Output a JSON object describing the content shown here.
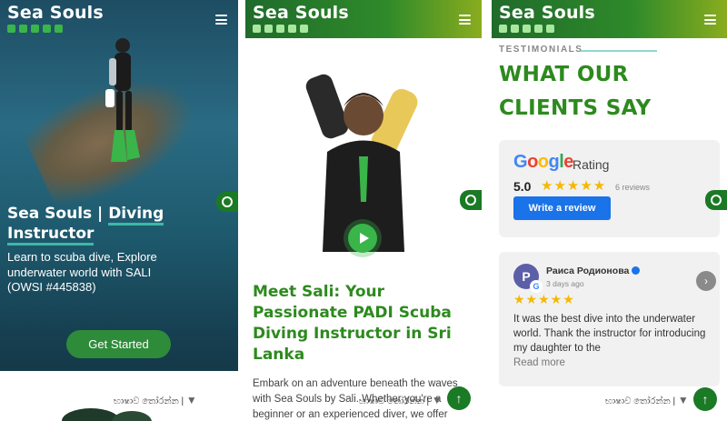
{
  "brand": "Sea Souls",
  "social_icons": [
    "youtube-icon",
    "facebook-icon",
    "instagram-icon",
    "whatsapp-icon",
    "tiktok-icon"
  ],
  "colors": {
    "primary_green": "#2d8a1e",
    "button_green": "#2e8b3a",
    "whatsapp_green": "#1a7a25",
    "google_blue": "#1a73e8",
    "star_gold": "#f5b800"
  },
  "panel1": {
    "hero_title_plain": "Sea Souls | ",
    "hero_title_highlight_1": "Diving",
    "hero_title_highlight_2": "Instructor",
    "hero_subtitle": "Learn to scuba dive, Explore underwater world with SALI (OWSI #445838)",
    "cta_label": "Get Started",
    "translate_label": "භාෂාව තෝරන්න"
  },
  "panel2": {
    "heading": "Meet Sali: Your Passionate PADI Scuba Diving Instructor in Sri Lanka",
    "body": "Embark on an adventure beneath the waves with Sea Souls by Sali. Whether you're a beginner or an experienced diver, we offer",
    "translate_label": "භාෂාව තෝරන්න"
  },
  "panel3": {
    "eyebrow": "TESTIMONIALS",
    "heading": "WHAT OUR CLIENTS SAY",
    "google_word": "Google",
    "rating_label": "Rating",
    "score": "5.0",
    "stars": "★★★★★",
    "review_count": "6  reviews",
    "write_review_label": "Write a review",
    "review": {
      "avatar_initial": "P",
      "name": "Раиса Родионова",
      "date": "3 days ago",
      "stars": "★★★★★",
      "text": "It was the best dive into the underwater world. Thank the instructor for introducing my daughter to the",
      "read_more": "Read more"
    },
    "translate_label": "භාෂාව තෝරන්න"
  }
}
